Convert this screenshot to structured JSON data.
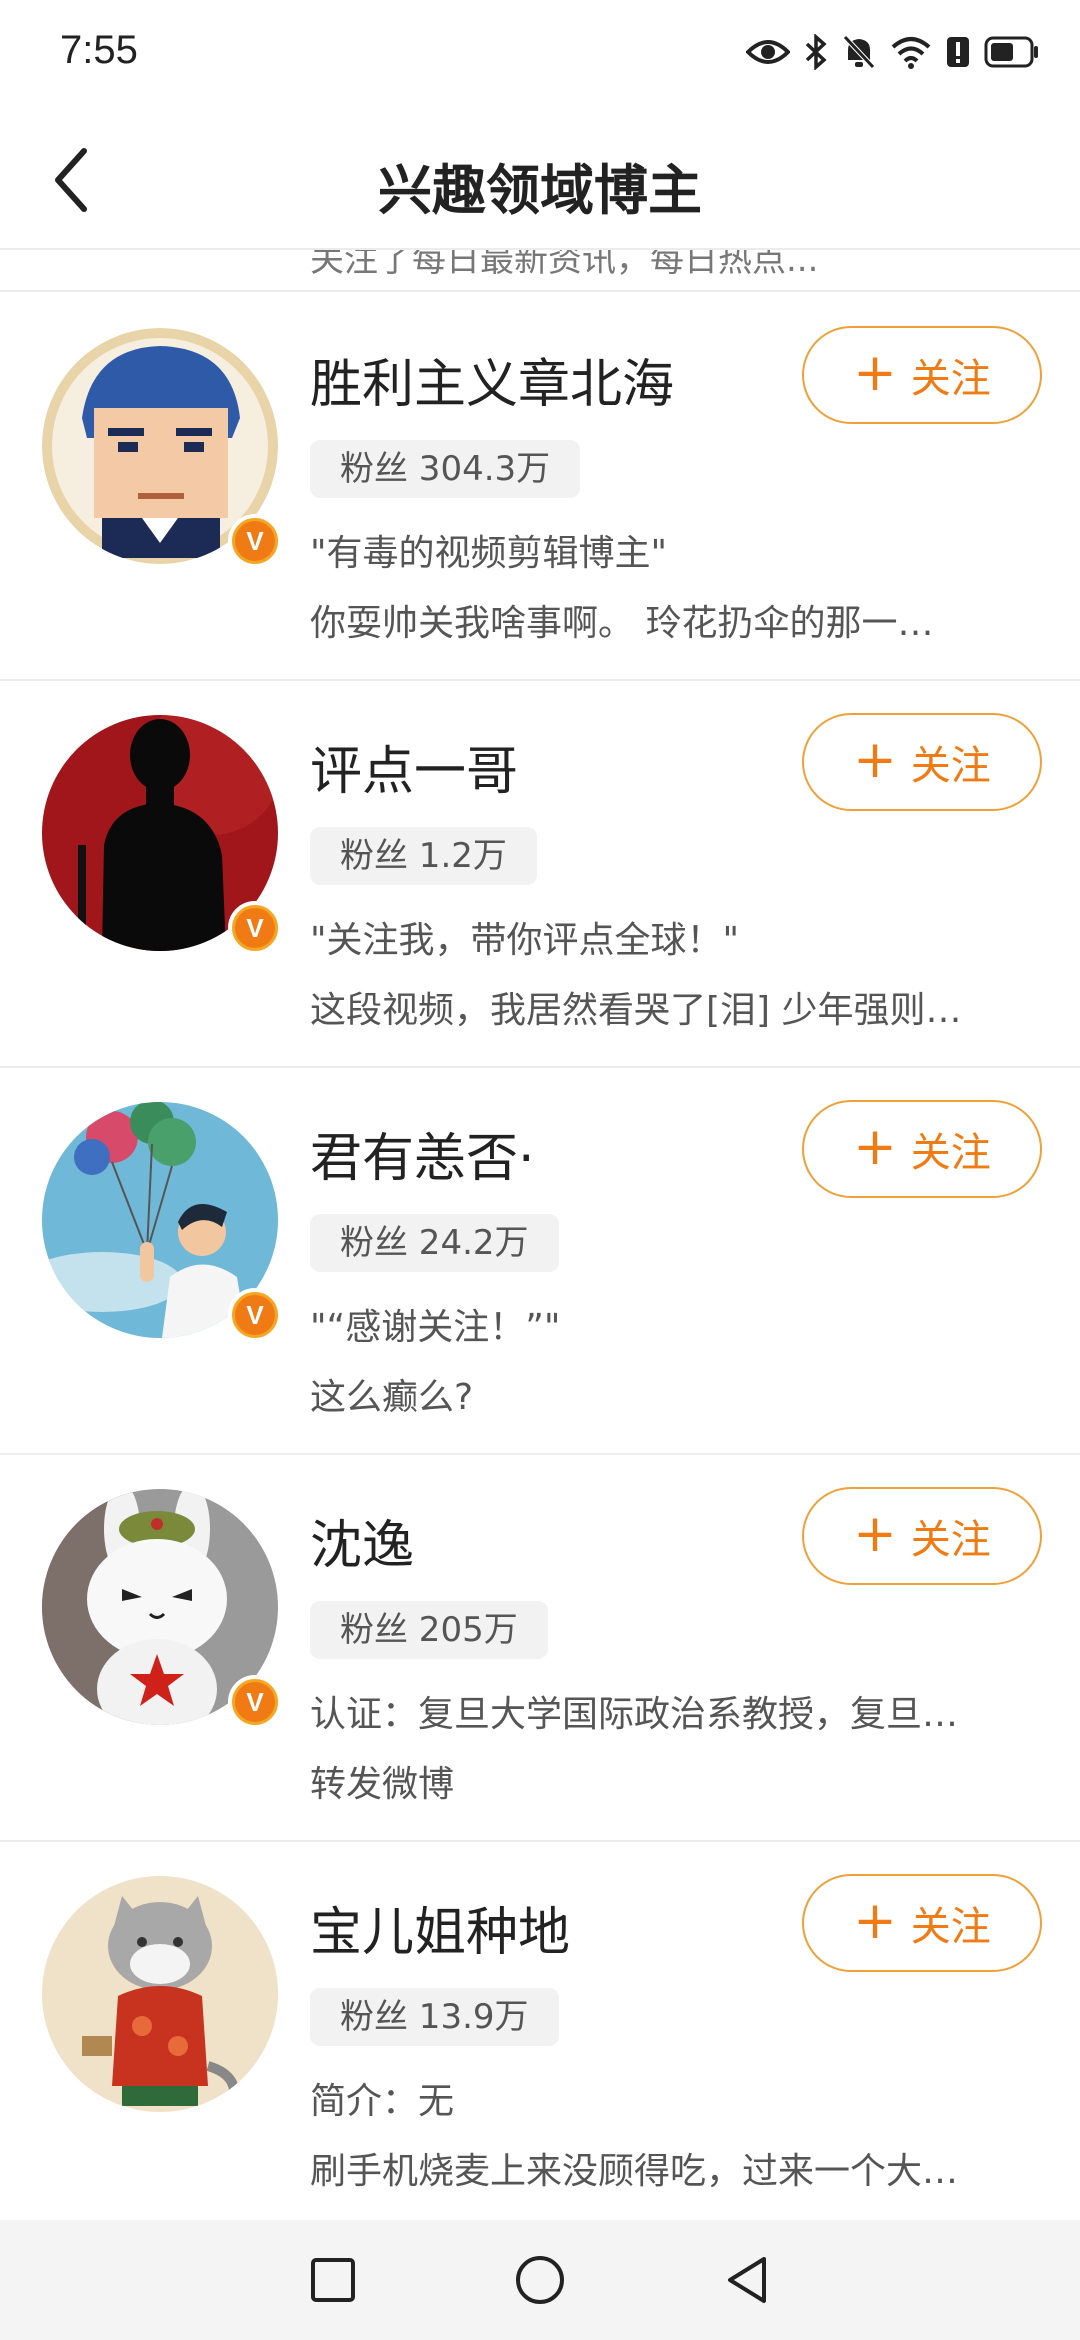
{
  "status_bar": {
    "time": "7:55"
  },
  "header": {
    "title": "兴趣领域博主"
  },
  "partial_row_text": "关注了每日最新资讯，每日热点...",
  "follow_label": "关注",
  "bloggers": [
    {
      "name": "胜利主义章北海",
      "fans": "粉丝 304.3万",
      "desc1": "\"有毒的视频剪辑博主\"",
      "desc2": "你耍帅关我啥事啊。 玲花扔伞的那一…"
    },
    {
      "name": "评点一哥",
      "fans": "粉丝 1.2万",
      "desc1": "\"关注我，带你评点全球！\"",
      "desc2": "这段视频，我居然看哭了[泪] 少年强则…"
    },
    {
      "name": "君有恙否·",
      "fans": "粉丝 24.2万",
      "desc1": "\"“感谢关注！”\"",
      "desc2": "这么癫么?"
    },
    {
      "name": "沈逸",
      "fans": "粉丝 205万",
      "desc1": "认证：复旦大学国际政治系教授，复旦…",
      "desc2": "转发微博"
    },
    {
      "name": "宝儿姐种地",
      "fans": "粉丝 13.9万",
      "desc1": "简介：无",
      "desc2": "刷手机烧麦上来没顾得吃，过来一个大…"
    }
  ],
  "colors": {
    "accent": "#f07b14",
    "badge": "#f5a623"
  },
  "icons": [
    "eye-icon",
    "bluetooth-icon",
    "mute-icon",
    "wifi-icon",
    "alert-icon",
    "battery-icon",
    "back-arrow-icon",
    "verified-icon",
    "plus-icon",
    "recents-icon",
    "home-icon",
    "back-nav-icon"
  ]
}
